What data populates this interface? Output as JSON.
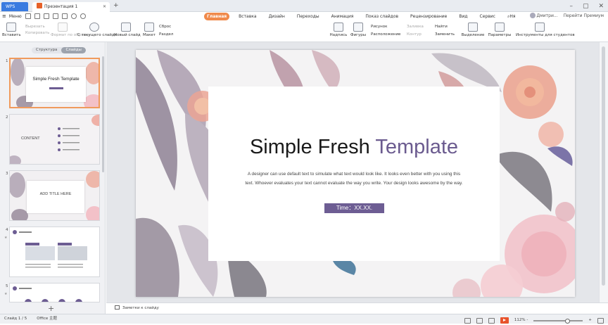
{
  "titlebar": {
    "app_tab": "WPS Office",
    "doc_tab": "Презентация 1",
    "close": "✕",
    "new_tab": "+"
  },
  "menu": {
    "label": "Меню"
  },
  "ribbon_tabs": [
    "Главная",
    "Вставка",
    "Дизайн",
    "Переходы",
    "Анимация",
    "Показ слайдов",
    "Рецензирование",
    "Вид",
    "Сервис"
  ],
  "find_tab": "Ня",
  "account": {
    "user": "Дмитри...",
    "share": "Перейти Премиум"
  },
  "ribbon": {
    "paste": "Вставить",
    "cut": "Вырезать",
    "copy": "Копировать",
    "format_painter": "Формат по образцу",
    "from_current": "С текущего слайда",
    "new_slide": "Новый слайд",
    "layout": "Макет",
    "reset": "Сброс",
    "section": "Раздел",
    "font_size": "0",
    "textbox": "Надпись",
    "shapes": "Фигуры",
    "picture": "Рисунок",
    "arrange": "Расположение",
    "fill": "Заливка",
    "outline": "Контур",
    "find": "Найти",
    "replace": "Заменить",
    "select": "Выделение",
    "params": "Параметры",
    "students": "Инструменты для студентов"
  },
  "panel": {
    "tab_outline": "Структура",
    "tab_slides": "Слайды",
    "add": "+",
    "thumbs": [
      {
        "num": "1",
        "title": "Simple Fresh Template"
      },
      {
        "num": "2",
        "title": "CONTENT"
      },
      {
        "num": "3",
        "title": "ADD TITLE HERE"
      },
      {
        "num": "4",
        "title": ""
      },
      {
        "num": "5",
        "title": ""
      }
    ]
  },
  "slide": {
    "title_main": "Simple Fresh ",
    "title_accent": "Template",
    "body": "A designer can use default text to simulate what text would look like. It looks even better with you using this text. Whoever evaluates your text cannot evaluate the way you write. Your design looks awesome by the way.",
    "time": "Time：XX.XX."
  },
  "notes": {
    "label": "Заметки к слайду"
  },
  "status": {
    "slide": "Слайд 1 / 5",
    "theme": "Office 主题",
    "zoom": "112% -"
  },
  "colors": {
    "accent": "#f08a4b",
    "brand": "#3a7be0",
    "template_accent": "#6b5b8f"
  }
}
